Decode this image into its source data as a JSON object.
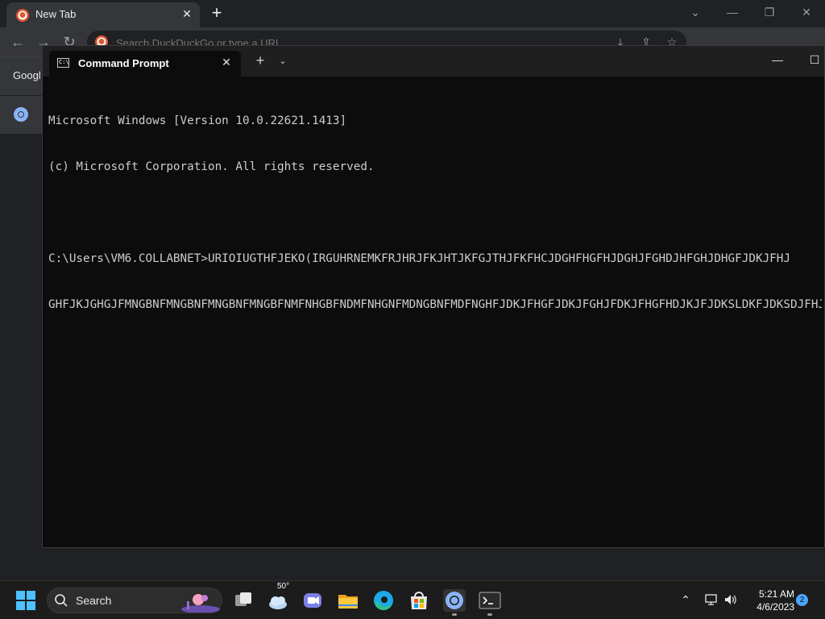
{
  "browser": {
    "tab_title": "New Tab",
    "omnibox_placeholder": "Search DuckDuckGo or type a URL",
    "bookmark_label": "Googl"
  },
  "terminal": {
    "tab_title": "Command Prompt",
    "lines": [
      "Microsoft Windows [Version 10.0.22621.1413]",
      "(c) Microsoft Corporation. All rights reserved.",
      "",
      "C:\\Users\\VM6.COLLABNET>URIOIUGTHFJEKO(IRGUHRNEMKFRJHRJFKJHTJKFGJTHJFKFHCJDGHFHGFHJDGHJFGHDJHFGHJDHGFJDKJFHJ",
      "GHFJKJGHGJFMNGBNFMNGBNFMNGBNFMNGBFNMFNHGBFNDMFNHGNFMDNGBNFMDFNGHFJDKJFHGFJDKJFGHJFDKJFHGFHDJKJFJDKSLDKFJDKSDJFHJD"
    ]
  },
  "taskbar": {
    "search_label": "Search",
    "weather_temp": "50°",
    "time": "5:21 AM",
    "date": "4/6/2023",
    "notification_count": "2"
  }
}
